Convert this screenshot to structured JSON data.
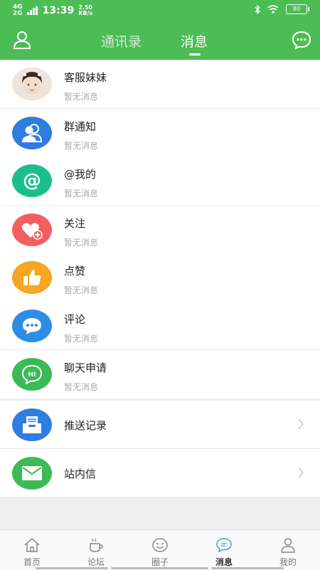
{
  "status_bar": {
    "network": "4G",
    "network2": "2G",
    "time": "13:39",
    "speed": "2.50",
    "speed_unit": "KB/s",
    "battery": "80"
  },
  "header": {
    "tabs": [
      {
        "label": "通讯录",
        "active": false
      },
      {
        "label": "消息",
        "active": true
      }
    ],
    "left_icon": "user-icon",
    "right_icon": "chat-bubble-icon"
  },
  "messages": [
    {
      "title": "客服妹妹",
      "subtitle": "暂无消息",
      "icon": "avatar-photo",
      "color": "#e9d8c9"
    },
    {
      "title": "群通知",
      "subtitle": "暂无消息",
      "icon": "group-icon",
      "color": "#2f7de1"
    },
    {
      "title": "@我的",
      "subtitle": "暂无消息",
      "icon": "at-icon",
      "color": "#1bbf8c"
    },
    {
      "title": "关注",
      "subtitle": "暂无消息",
      "icon": "heart-plus-icon",
      "color": "#f25f5f"
    },
    {
      "title": "点赞",
      "subtitle": "暂无消息",
      "icon": "thumbs-up-icon",
      "color": "#f6a623"
    },
    {
      "title": "评论",
      "subtitle": "暂无消息",
      "icon": "comment-icon",
      "color": "#2d8ce6"
    },
    {
      "title": "聊天申请",
      "subtitle": "暂无消息",
      "icon": "hi-bubble-icon",
      "color": "#3cba54"
    }
  ],
  "links": [
    {
      "title": "推送记录",
      "icon": "inbox-icon",
      "color": "#2f7de1"
    },
    {
      "title": "站内信",
      "icon": "mail-icon",
      "color": "#3cba54"
    }
  ],
  "bottom_nav": [
    {
      "label": "首页",
      "icon": "home-icon",
      "active": false
    },
    {
      "label": "论坛",
      "icon": "coffee-icon",
      "active": false
    },
    {
      "label": "圈子",
      "icon": "smile-icon",
      "active": false
    },
    {
      "label": "消息",
      "icon": "message-icon",
      "active": true
    },
    {
      "label": "我的",
      "icon": "person-icon",
      "active": false
    }
  ]
}
